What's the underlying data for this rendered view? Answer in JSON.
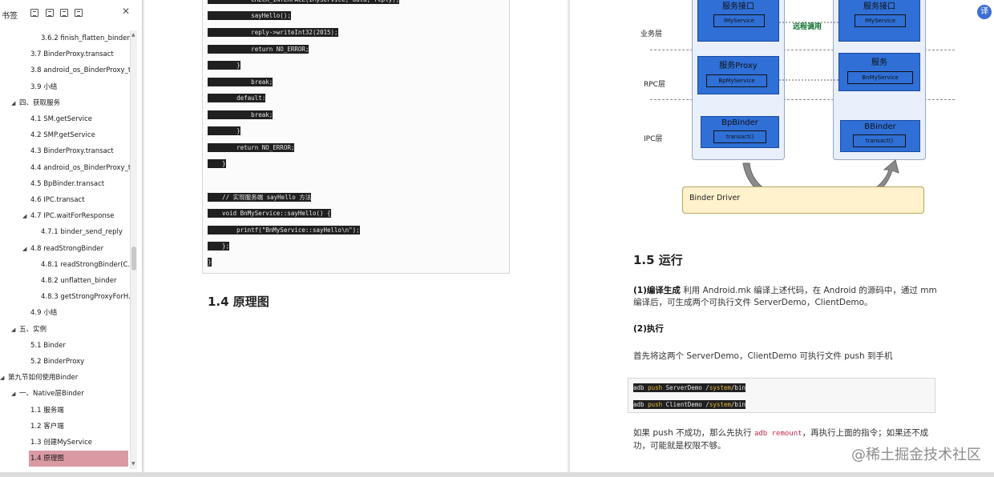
{
  "sidebar": {
    "title": "书签",
    "close_glyph": "✕",
    "items": [
      {
        "label": "3.6.2 finish_flatten_binder",
        "level": 3,
        "toggle": ""
      },
      {
        "label": "3.7 BinderProxy.transact",
        "level": 2,
        "toggle": ""
      },
      {
        "label": "3.8 android_os_BinderProxy_t...",
        "level": 2,
        "toggle": ""
      },
      {
        "label": "3.9 小结",
        "level": 2,
        "toggle": ""
      },
      {
        "label": "四、获取服务",
        "level": 1,
        "toggle": "◢"
      },
      {
        "label": "4.1 SM.getService",
        "level": 2,
        "toggle": ""
      },
      {
        "label": "4.2 SMP.getService",
        "level": 2,
        "toggle": ""
      },
      {
        "label": "4.3 BinderProxy.transact",
        "level": 2,
        "toggle": ""
      },
      {
        "label": "4.4 android_os_BinderProxy_t...",
        "level": 2,
        "toggle": ""
      },
      {
        "label": "4.5 BpBinder.transact",
        "level": 2,
        "toggle": ""
      },
      {
        "label": "4.6 IPC.transact",
        "level": 2,
        "toggle": ""
      },
      {
        "label": "4.7 IPC.waitForResponse",
        "level": 2,
        "toggle": "◢"
      },
      {
        "label": "4.7.1 binder_send_reply",
        "level": 3,
        "toggle": ""
      },
      {
        "label": "4.8 readStrongBinder",
        "level": 2,
        "toggle": "◢"
      },
      {
        "label": "4.8.1 readStrongBinder(C...",
        "level": 3,
        "toggle": ""
      },
      {
        "label": "4.8.2 unflatten_binder",
        "level": 3,
        "toggle": ""
      },
      {
        "label": "4.8.3 getStrongProxyForH...",
        "level": 3,
        "toggle": ""
      },
      {
        "label": "4.9 小结",
        "level": 2,
        "toggle": ""
      },
      {
        "label": "五、实例",
        "level": 1,
        "toggle": "◢"
      },
      {
        "label": "5.1 Binder",
        "level": 2,
        "toggle": ""
      },
      {
        "label": "5.2 BinderProxy",
        "level": 2,
        "toggle": ""
      },
      {
        "label": "第九节如何使用Binder",
        "level": 0,
        "toggle": "◢"
      },
      {
        "label": "一、Native层Binder",
        "level": 1,
        "toggle": "◢"
      },
      {
        "label": "1.1 服务端",
        "level": 2,
        "toggle": ""
      },
      {
        "label": "1.2 客户端",
        "level": 2,
        "toggle": ""
      },
      {
        "label": "1.3 创建MyService",
        "level": 2,
        "toggle": ""
      },
      {
        "label": "1.4 原理图",
        "level": 2,
        "toggle": "",
        "active": true
      }
    ]
  },
  "left_page": {
    "code_lines": [
      {
        "indent": 0,
        "text": "            CHECK_INTERFACE(IMyService, data, reply);"
      },
      {
        "indent": 0,
        "text": "            sayHello();"
      },
      {
        "indent": 0,
        "text": "            reply->writeInt32(2015);"
      },
      {
        "indent": 0,
        "text": "            return NO_ERROR;"
      },
      {
        "indent": 0,
        "text": "        }"
      },
      {
        "indent": 0,
        "text": "            break;"
      },
      {
        "indent": 0,
        "text": "        default:"
      },
      {
        "indent": 0,
        "text": "            break;"
      },
      {
        "indent": 0,
        "text": "        }"
      },
      {
        "indent": 0,
        "text": "        return NO_ERROR;"
      },
      {
        "indent": 0,
        "text": "    }"
      },
      {
        "indent": 0,
        "text": ""
      },
      {
        "indent": 0,
        "text": "    // 实现服务端 sayHello 方法"
      },
      {
        "indent": 0,
        "text": "    void BnMyService::sayHello() {"
      },
      {
        "indent": 0,
        "text": "        printf(\"BnMyService::sayHello\\n\");"
      },
      {
        "indent": 0,
        "text": "    };"
      },
      {
        "indent": 0,
        "text": "}"
      }
    ],
    "section_heading": "1.4  原理图"
  },
  "diagram": {
    "layers": [
      "业务层",
      "RPC层",
      "IPC层"
    ],
    "left_column": {
      "top_title": "服务接口",
      "top_inner": "IMyService",
      "mid_title": "服务Proxy",
      "mid_inner": "BpMyService",
      "low_title": "BpBinder",
      "low_inner": "transact()"
    },
    "right_column": {
      "top_title": "服务接口",
      "top_inner": "IMyService",
      "mid_title": "服务",
      "mid_inner": "BnMyService",
      "low_title": "BBinder",
      "low_inner": "transact()"
    },
    "remote_call": "远程调用",
    "driver": "Binder Driver"
  },
  "right_page": {
    "section_heading": "1.5  运行",
    "p1_bold": "(1)编译生成",
    "p1_text": " 利用 Android.mk 编译上述代码，在 Android 的源码中，通过 mm 编译后，可生成两个可执行文件 ServerDemo，ClientDemo。",
    "p2_bold": "(2)执行",
    "p3_text": "首先将这两个 ServerDemo，ClientDemo 可执行文件 push 到手机",
    "cmd_lines": [
      {
        "a": "adb ",
        "b": "push",
        "c": " ServerDemo /",
        "d": "system",
        "e": "/bin"
      },
      {
        "a": "adb ",
        "b": "push",
        "c": " ClientDemo /",
        "d": "system",
        "e": "/bin"
      }
    ],
    "p4_pre": "如果 push 不成功，那么先执行 ",
    "p4_code": "adb remount",
    "p4_post": "，再执行上面的指令；如果还不成功，可能就是权限不够。"
  },
  "watermark": "@稀土掘金技术社区",
  "corner_icon": "译",
  "colors": {
    "active_bookmark": "#d99aa4",
    "diagram_blue": "#2f6fd6",
    "driver_fill": "#fff2cc",
    "code_bg": "#202020",
    "remote_call_green": "#0c6e2d"
  }
}
